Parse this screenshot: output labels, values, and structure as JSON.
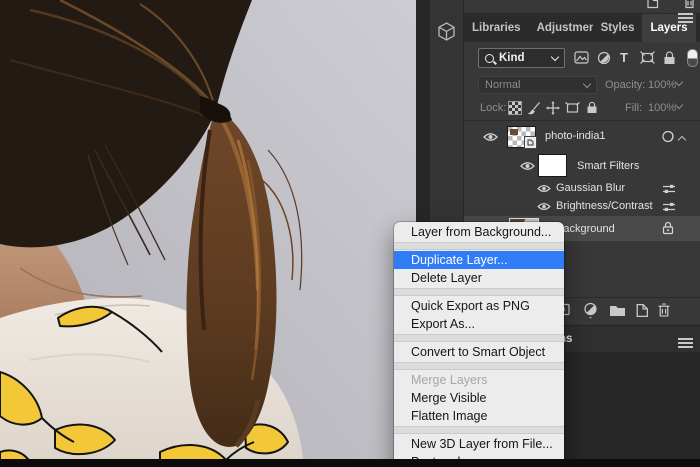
{
  "panel": {
    "tabs": [
      "Libraries",
      "Adjustments",
      "Styles",
      "Layers"
    ],
    "active_tab": "Layers",
    "filter_bar": {
      "kind_label": "Kind"
    },
    "blend_bar": {
      "mode": "Normal",
      "opacity_label": "Opacity:",
      "opacity_value": "100%"
    },
    "lock_bar": {
      "label": "Lock:",
      "fill_label": "Fill:",
      "fill_value": "100%"
    },
    "layers": [
      {
        "name": "photo-india1",
        "kind": "smart-object",
        "visible": true
      },
      {
        "name": "Smart Filters",
        "kind": "smart-filters-mask",
        "visible": true
      },
      {
        "name": "Gaussian Blur",
        "kind": "smart-filter",
        "visible": true
      },
      {
        "name": "Brightness/Contrast",
        "kind": "smart-filter",
        "visible": true
      },
      {
        "name": "Background",
        "kind": "background",
        "locked": true,
        "selected": true
      }
    ],
    "lower_tab_fragment": "ns"
  },
  "context_menu": {
    "items": [
      {
        "label": "Layer from Background...",
        "state": "normal"
      },
      {
        "label": "Duplicate Layer...",
        "state": "highlighted"
      },
      {
        "label": "Delete Layer",
        "state": "normal"
      },
      {
        "label": "Quick Export as PNG",
        "state": "normal"
      },
      {
        "label": "Export As...",
        "state": "normal"
      },
      {
        "label": "Convert to Smart Object",
        "state": "normal"
      },
      {
        "label": "Merge Layers",
        "state": "disabled"
      },
      {
        "label": "Merge Visible",
        "state": "normal"
      },
      {
        "label": "Flatten Image",
        "state": "normal"
      },
      {
        "label": "New 3D Layer from File...",
        "state": "normal"
      },
      {
        "label": "Postcard",
        "state": "normal"
      }
    ]
  },
  "icons": {
    "dock": "3d-cube",
    "tab_bar_menu": "hamburger-menu",
    "kind_search": "magnifier",
    "filter_row": [
      "image",
      "adjustment",
      "type",
      "shape",
      "smart-object",
      "filter-toggle"
    ],
    "lock_row": [
      "transparent-pixels",
      "brush",
      "move",
      "artboard",
      "lock-all"
    ],
    "layer_right": [
      "smart-filter-badge",
      "collapse-caret",
      "filter-settings",
      "lock"
    ],
    "bottom_row": [
      "layer-mask",
      "adjustment-layer",
      "group-folder",
      "new-layer",
      "delete-layer"
    ],
    "top_strip": [
      "new-layer",
      "delete-layer"
    ]
  },
  "colors": {
    "menu_highlight": "#2f7cf6",
    "menu_bg": "#ececed",
    "panel_bg": "#383838",
    "selected_row": "#4a4a4a",
    "shirt_yellow": "#f2c738"
  }
}
